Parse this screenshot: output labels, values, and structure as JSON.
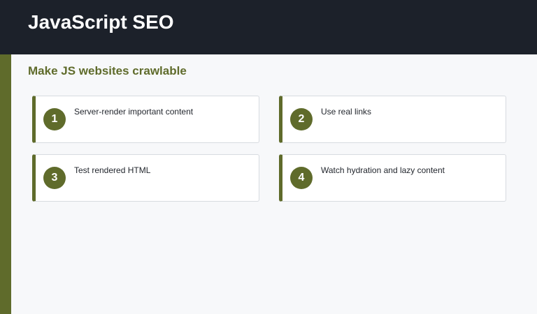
{
  "header": {
    "title": "JavaScript SEO"
  },
  "main": {
    "subtitle": "Make JS websites crawlable",
    "cards": [
      {
        "number": "1",
        "text": "Server-render important content"
      },
      {
        "number": "2",
        "text": "Use real links"
      },
      {
        "number": "3",
        "text": "Test rendered HTML"
      },
      {
        "number": "4",
        "text": "Watch hydration and lazy content"
      }
    ]
  },
  "colors": {
    "header_bg": "#1c212a",
    "accent": "#5f6b2b",
    "page_bg": "#f7f8fa",
    "card_bg": "#ffffff"
  }
}
